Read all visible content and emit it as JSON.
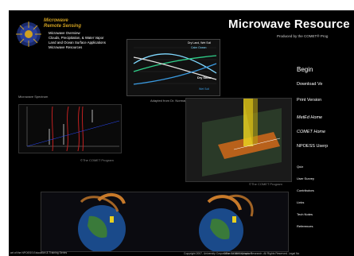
{
  "header": {
    "title": "Microwave Resource",
    "subtitle": "Produced by the COMET® Prog"
  },
  "logo": {
    "title_lines": [
      "Microwave",
      "Remote Sensing"
    ]
  },
  "top_links": [
    "Microwave Overview",
    "Clouds, Precipitation, & Water Vapor",
    "Land and Ocean Surface Applications",
    "Microwave Resources"
  ],
  "spectrum": {
    "title": "Microwave Spectrum",
    "copyright": "©The COMET Program"
  },
  "graph": {
    "legend": [
      "Dry Land, Wet Soil",
      "Calm Ocean",
      "Dry Snow",
      "Wet Soil"
    ],
    "caption": "Adapted from Dr. Norman C. Grody"
  },
  "map_panel": {
    "copyright": "©The COMET Program"
  },
  "globes": {
    "copyright": "©The COMET Program"
  },
  "right_nav": {
    "begin": "Begin",
    "links": [
      "Download Ve",
      "Print Version",
      "MetEd Home",
      "COMET Home",
      "NPOESS Userp"
    ],
    "small": [
      "Quiz",
      "User Survey",
      "Contributors",
      "Links",
      "Tech Notes",
      "References"
    ]
  },
  "footer": {
    "left": "art of the NPOESS Education & Training Series",
    "right": "Copyright 2007, University Corporation for Atmospheric Research. All Rights Reserved. Legal No"
  },
  "colors": {
    "accent": "#d0a020",
    "background": "#000000"
  }
}
